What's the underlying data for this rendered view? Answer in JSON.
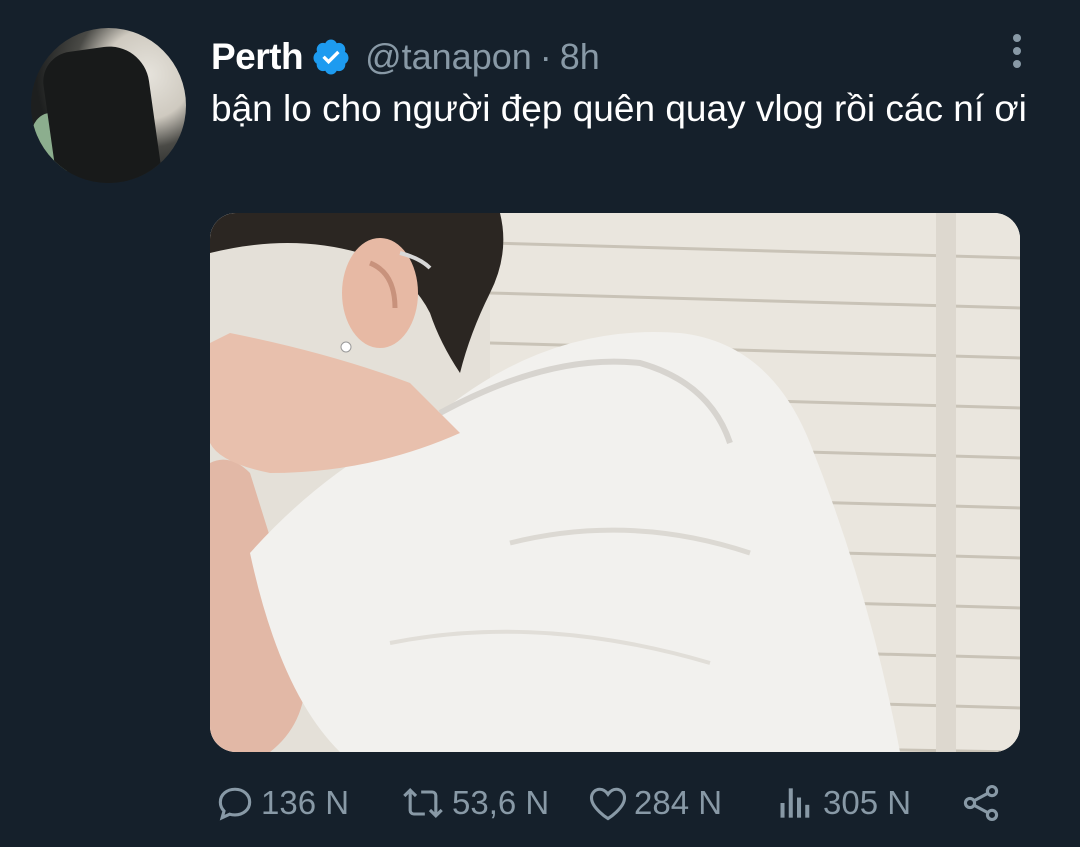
{
  "tweet": {
    "author_name": "Perth",
    "handle": "@tanapon",
    "separator": "·",
    "time": "8h",
    "text": "bận lo cho người đẹp quên quay vlog rồi các ní ơi"
  },
  "actions": {
    "replies": "136 N",
    "retweets": "53,6 N",
    "likes": "284 N",
    "views": "305 N"
  },
  "icons": {
    "verified": "verified-badge-icon",
    "more": "more-vertical-icon",
    "reply": "comment-icon",
    "retweet": "retweet-icon",
    "like": "heart-icon",
    "views": "analytics-icon",
    "share": "share-icon"
  },
  "colors": {
    "background": "#15202b",
    "secondary_text": "#8899a6",
    "verified": "#1d9bf0"
  }
}
